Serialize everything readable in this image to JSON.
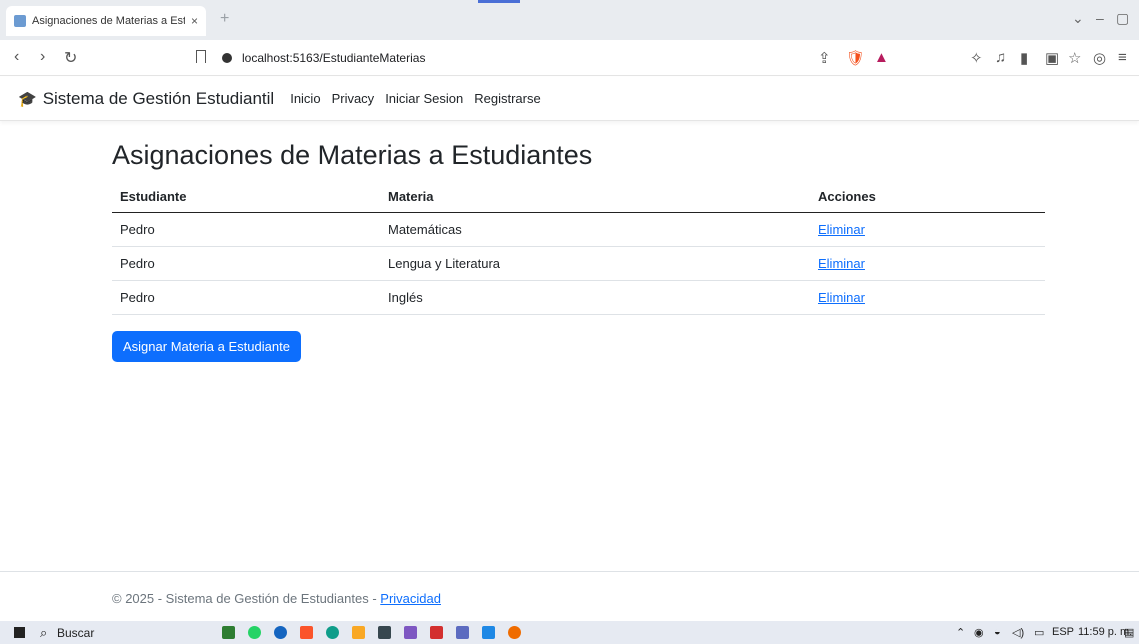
{
  "browser": {
    "tab_title": "Asignaciones de Materias a Est",
    "tab_close": "×",
    "new_tab": "+",
    "url": "localhost:5163/EstudianteMaterias"
  },
  "navbar": {
    "brand": "Sistema de Gestión Estudiantil",
    "links": [
      "Inicio",
      "Privacy",
      "Iniciar Sesion",
      "Registrarse"
    ]
  },
  "main": {
    "title": "Asignaciones de Materias a Estudiantes",
    "headers": [
      "Estudiante",
      "Materia",
      "Acciones"
    ],
    "rows": [
      {
        "estudiante": "Pedro",
        "materia": "Matemáticas",
        "accion": "Eliminar"
      },
      {
        "estudiante": "Pedro",
        "materia": "Lengua y Literatura",
        "accion": "Eliminar"
      },
      {
        "estudiante": "Pedro",
        "materia": "Inglés",
        "accion": "Eliminar"
      }
    ],
    "assign_button": "Asignar Materia a Estudiante"
  },
  "footer": {
    "prefix": "© 2025 - Sistema de Gestión de Estudiantes - ",
    "link": "Privacidad"
  },
  "taskbar": {
    "search_label": "Buscar",
    "language": "ESP",
    "time": "11:59 p. m."
  },
  "colors": {
    "primary": "#0d6efd",
    "link": "#0d6efd",
    "taskbar": "#e6eaf2"
  }
}
